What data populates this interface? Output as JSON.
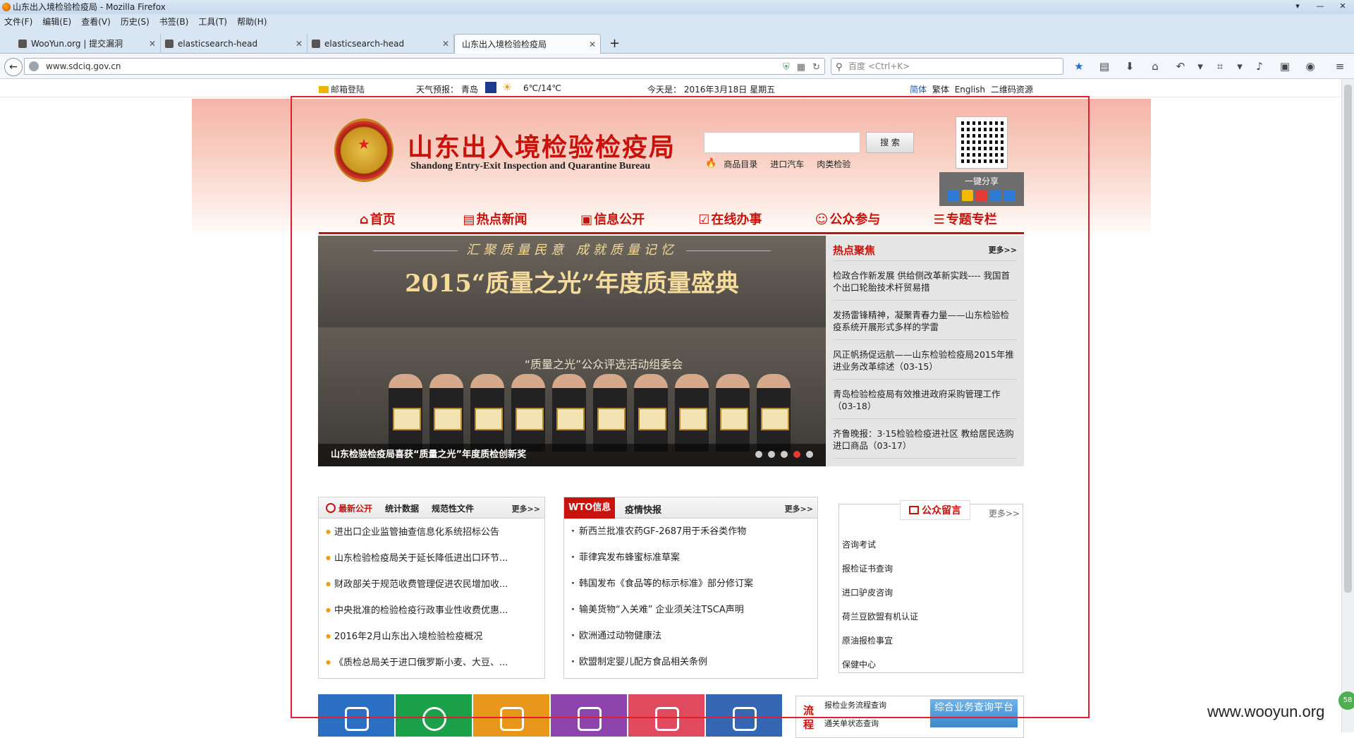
{
  "window": {
    "title": "山东出入境检验检疫局 - Mozilla Firefox",
    "controls": [
      "▾",
      "—",
      "✕"
    ]
  },
  "menubar": [
    "文件(F)",
    "编辑(E)",
    "查看(V)",
    "历史(S)",
    "书签(B)",
    "工具(T)",
    "帮助(H)"
  ],
  "tabs": [
    {
      "label": "WooYun.org | 提交漏洞",
      "active": false
    },
    {
      "label": "elasticsearch-head",
      "active": false
    },
    {
      "label": "elasticsearch-head",
      "active": false
    },
    {
      "label": "山东出入境检验检疫局",
      "active": true
    }
  ],
  "newtab": "+",
  "nav": {
    "url": "www.sdciq.gov.cn",
    "search_placeholder": "百度 <Ctrl+K>"
  },
  "topstrip": {
    "mail": "邮箱登陆",
    "weather_label": "天气预报：",
    "city": "青岛",
    "temp": "6℃/14℃",
    "date": "今天是： 2016年3月18日 星期五",
    "langs": [
      "简体",
      "繁体",
      "English",
      "二维码资源"
    ]
  },
  "header": {
    "title": "山东出入境检验检疫局",
    "subtitle": "Shandong Entry-Exit Inspection and Quarantine Bureau",
    "search_button": "搜 索",
    "hot_links": [
      "商品目录",
      "进口汽车",
      "肉类检验"
    ],
    "share_label": "一键分享"
  },
  "mainnav": [
    {
      "label": "首页",
      "icon": "home-icon",
      "glyph": "⌂"
    },
    {
      "label": "热点新闻",
      "icon": "news-icon",
      "glyph": "▤"
    },
    {
      "label": "信息公开",
      "icon": "info-icon",
      "glyph": "▣"
    },
    {
      "label": "在线办事",
      "icon": "online-icon",
      "glyph": "☑"
    },
    {
      "label": "公众参与",
      "icon": "people-icon",
      "glyph": "☺"
    },
    {
      "label": "专题专栏",
      "icon": "list-icon",
      "glyph": "☰"
    }
  ],
  "slider": {
    "line1": "汇聚质量民意 成就质量记忆",
    "line2": "2015“质量之光”年度质量盛典",
    "stage_text": "“质量之光”公众评选活动组委会",
    "caption": "山东检验检疫局喜获“质量之光”年度质检创新奖",
    "dots_active_index": 3
  },
  "focus": {
    "title": "热点聚焦",
    "more": "更多>>",
    "items": [
      "检政合作新发展 供给侧改革新实践---- 我国首个出口轮胎技术杆贸易措",
      "发扬雷锋精神，凝聚青春力量——山东检验检疫系统开展形式多样的学雷",
      "风正帆扬促远航——山东检验检疫局2015年推进业务改革综述（03-15）",
      "青岛检验检疫局有效推进政府采购管理工作（03-18）",
      "齐鲁晚报：3·15检验检疫进社区 教给居民选购进口商品（03-17）"
    ]
  },
  "box1": {
    "tabs": [
      "最新公开",
      "统计数据",
      "规范性文件"
    ],
    "more": "更多>>",
    "items": [
      "进出口企业监管抽查信息化系统招标公告",
      "山东检验检疫局关于延长降低进出口环节...",
      "财政部关于规范收费管理促进农民增加收...",
      "中央批准的检验检疫行政事业性收费优惠...",
      "2016年2月山东出入境检验检疫概况",
      "《质检总局关于进口俄罗斯小麦、大豆、..."
    ]
  },
  "box2": {
    "tab_active": "WTO信息",
    "tab2": "疫情快报",
    "more": "更多>>",
    "items": [
      "新西兰批准农药GF-2687用于禾谷类作物",
      "菲律宾发布蜂蜜标准草案",
      "韩国发布《食品等的标示标准》部分修订案",
      "输美货物“入关难” 企业须关注TSCA声明",
      "欧洲通过动物健康法",
      "欧盟制定婴儿配方食品相关条例"
    ]
  },
  "box3": {
    "title": "公众留言",
    "more": "更多>>",
    "items": [
      "咨询考试",
      "报检证书查询",
      "进口驴皮咨询",
      "荷兰豆欧盟有机认证",
      "原油报检事宜",
      "保健中心"
    ]
  },
  "tiles": [
    {
      "icon": "tv-icon",
      "color": "#2a6fc4"
    },
    {
      "icon": "phone-icon",
      "color": "#1aa048"
    },
    {
      "icon": "tag-icon",
      "color": "#e8961a"
    },
    {
      "icon": "signpost-icon",
      "color": "#8e44ad"
    },
    {
      "icon": "monitor-icon",
      "color": "#e04a5f"
    },
    {
      "icon": "newspaper-icon",
      "color": "#3466b4"
    }
  ],
  "flow": {
    "label": "流程",
    "link1": "报检业务流程查询",
    "link2": "通关单状态查询",
    "button": "综合业务查询平台"
  },
  "watermark": "www.wooyun.org",
  "badge": "58"
}
